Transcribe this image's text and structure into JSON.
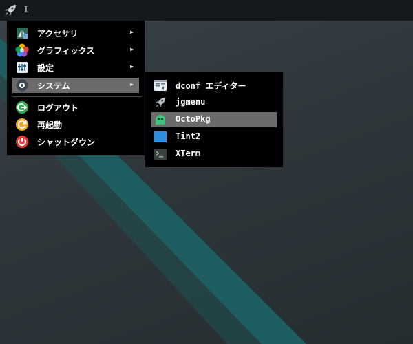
{
  "taskbar": {
    "launcher_icon": "rocket-icon",
    "text_cursor": "I"
  },
  "main_menu": {
    "items": [
      {
        "label": "アクセサリ",
        "icon": "accessories-icon",
        "has_submenu": true
      },
      {
        "label": "グラフィックス",
        "icon": "graphics-icon",
        "has_submenu": true
      },
      {
        "label": "設定",
        "icon": "settings-icon",
        "has_submenu": true
      },
      {
        "label": "システム",
        "icon": "system-icon",
        "has_submenu": true,
        "active": true
      }
    ],
    "session_items": [
      {
        "label": "ログアウト",
        "icon": "logout-icon"
      },
      {
        "label": "再起動",
        "icon": "restart-icon"
      },
      {
        "label": "シャットダウン",
        "icon": "shutdown-icon"
      }
    ],
    "arrow": "▶"
  },
  "submenu": {
    "items": [
      {
        "label": "dconf エディター",
        "icon": "dconf-editor-icon"
      },
      {
        "label": "jgmenu",
        "icon": "rocket-icon"
      },
      {
        "label": "OctoPkg",
        "icon": "octopkg-icon",
        "active": true
      },
      {
        "label": "Tint2",
        "icon": "tint2-icon"
      },
      {
        "label": "XTerm",
        "icon": "terminal-icon"
      }
    ]
  },
  "colors": {
    "menu_bg": "#000000",
    "highlight": "#6b6b6b",
    "taskbar": "#16191c",
    "desktop_teal": "#1f5f61"
  }
}
